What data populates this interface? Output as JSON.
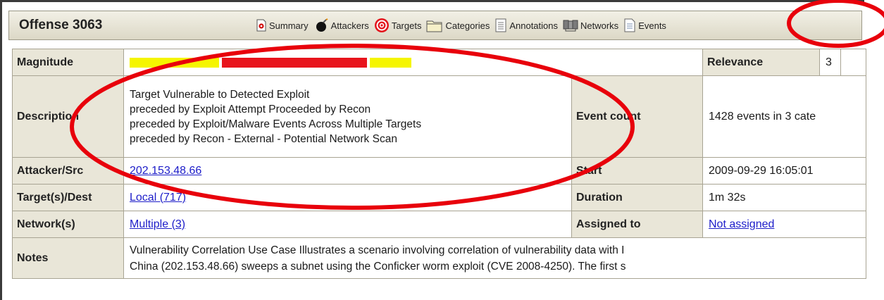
{
  "header": {
    "title": "Offense 3063"
  },
  "toolbar": {
    "items": [
      {
        "label": "Summary",
        "icon": "summary-icon"
      },
      {
        "label": "Attackers",
        "icon": "bomb-icon"
      },
      {
        "label": "Targets",
        "icon": "target-icon"
      },
      {
        "label": "Categories",
        "icon": "folder-icon"
      },
      {
        "label": "Annotations",
        "icon": "annotations-icon"
      },
      {
        "label": "Networks",
        "icon": "network-icon"
      },
      {
        "label": "Events",
        "icon": "events-icon"
      }
    ]
  },
  "details": {
    "magnitude_label": "Magnitude",
    "magnitude_bar": {
      "yellow_left": 0.325,
      "red": 0.525,
      "yellow_right": 0.15
    },
    "relevance_label": "Relevance",
    "relevance_value": "3",
    "description_label": "Description",
    "description_lines": [
      "Target Vulnerable to Detected Exploit",
      "preceded by Exploit Attempt Proceeded by Recon",
      "preceded by Exploit/Malware Events Across Multiple Targets",
      "preceded by Recon - External - Potential Network Scan"
    ],
    "event_count_label": "Event count",
    "event_count_value": "1428 events in 3 cate",
    "attacker_label": "Attacker/Src",
    "attacker_value": "202.153.48.66",
    "start_label": "Start",
    "start_value": "2009-09-29 16:05:01",
    "target_label": "Target(s)/Dest",
    "target_value": "Local (717)",
    "duration_label": "Duration",
    "duration_value": "1m 32s",
    "network_label": "Network(s)",
    "network_value": "Multiple (3)",
    "assigned_label": "Assigned to",
    "assigned_value": "Not assigned",
    "notes_label": "Notes",
    "notes_lines": [
      "Vulnerability Correlation Use Case Illustrates a scenario involving correlation of vulnerability data with I",
      "China (202.153.48.66) sweeps a subnet using the Conficker worm exploit (CVE 2008-4250). The first s"
    ]
  },
  "colors": {
    "annotation": "#e8000b",
    "link": "#1d1dc9",
    "label_bg": "#e9e6d8",
    "bar_yellow": "#f5f500",
    "bar_red": "#e8141c"
  }
}
